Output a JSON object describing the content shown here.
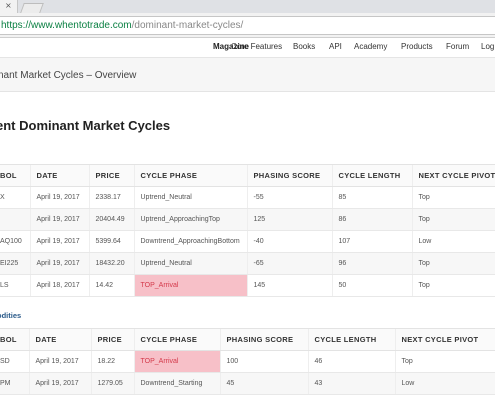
{
  "browser": {
    "tab_close_glyph": "×",
    "url_secure_part": "https://www.whentotrade.com",
    "url_path_part": "/dominant-market-cycles/"
  },
  "nav": {
    "items": [
      "Magazine",
      "Core Features",
      "Books",
      "API",
      "Academy",
      "Products",
      "Forum",
      "Log"
    ],
    "active_index": 0
  },
  "page": {
    "breadcrumb_title": "nant Market Cycles – Overview",
    "section_heading": "ent Dominant Market Cycles"
  },
  "table1": {
    "headers": [
      "BOL",
      "DATE",
      "PRICE",
      "CYCLE PHASE",
      "PHASING SCORE",
      "CYCLE LENGTH",
      "NEXT CYCLE PIVOT"
    ],
    "rows": [
      [
        "X",
        "April 19, 2017",
        "2338.17",
        "Uptrend_Neutral",
        "-55",
        "85",
        "Top"
      ],
      [
        "",
        "April 19, 2017",
        "20404.49",
        "Uptrend_ApproachingTop",
        "125",
        "86",
        "Top"
      ],
      [
        "AQ100",
        "April 19, 2017",
        "5399.64",
        "Downtrend_ApproachingBottom",
        "-40",
        "107",
        "Low"
      ],
      [
        "EI225",
        "April 19, 2017",
        "18432.20",
        "Uptrend_Neutral",
        "-65",
        "96",
        "Top"
      ],
      [
        "LS",
        "April 18, 2017",
        "14.42",
        "TOP_Arrival",
        "145",
        "50",
        "Top"
      ]
    ],
    "highlight": [
      [
        4,
        3
      ]
    ]
  },
  "commodities_label": "odities",
  "table2": {
    "headers": [
      "BOL",
      "DATE",
      "PRICE",
      "CYCLE PHASE",
      "PHASING SCORE",
      "CYCLE LENGTH",
      "NEXT CYCLE PIVOT"
    ],
    "rows": [
      [
        "SD",
        "April 19, 2017",
        "18.22",
        "TOP_Arrival",
        "100",
        "46",
        "Top"
      ],
      [
        "PM",
        "April 19, 2017",
        "1279.05",
        "Downtrend_Starting",
        "45",
        "43",
        "Low"
      ]
    ],
    "highlight": [
      [
        0,
        3
      ]
    ]
  },
  "colors": {
    "highlight_bg": "#f7c0c8",
    "highlight_text": "#d43a4b",
    "url_green": "#0b8043"
  }
}
